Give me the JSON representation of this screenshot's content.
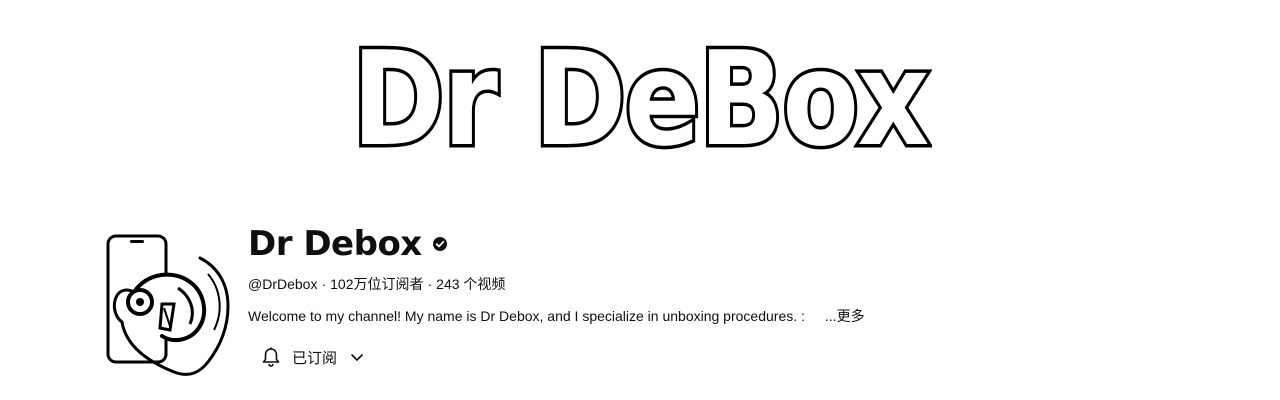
{
  "banner": {
    "title": "Dr DeBox"
  },
  "channel": {
    "name": "Dr Debox",
    "verified_icon": "verified-check-icon",
    "handle": "@DrDebox",
    "separator": "·",
    "subscribers": "102万位订阅者",
    "videos": "243 个视频",
    "description": "Welcome to my channel! My name is Dr Debox, and I specialize in unboxing procedures. :",
    "more_label": "...更多",
    "subscribe": {
      "bell_icon": "bell-icon",
      "label": "已订阅",
      "chevron_icon": "chevron-down-icon"
    }
  },
  "colors": {
    "background": "#ffffff",
    "text": "#0f0f0f"
  }
}
